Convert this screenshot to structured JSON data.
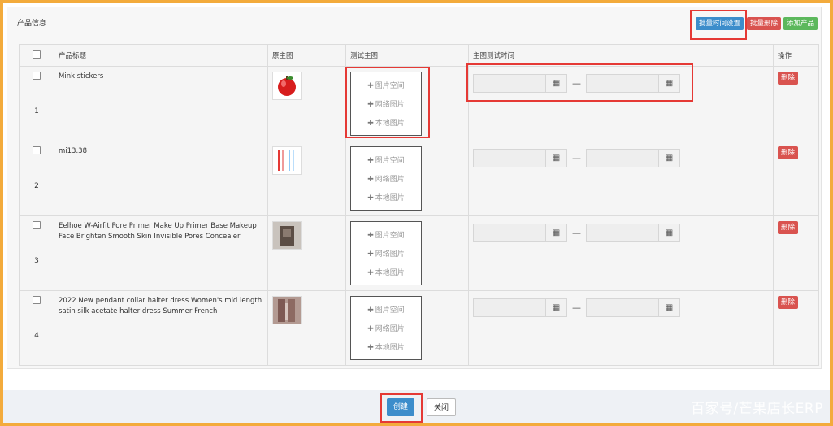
{
  "panel": {
    "title": "产品信息"
  },
  "toolbar": {
    "batch_time_label": "批量时间设置",
    "batch_delete_label": "批量删除",
    "add_product_label": "添加产品"
  },
  "table": {
    "headers": {
      "product_title": "产品标题",
      "original_image": "原主图",
      "test_image": "测试主图",
      "test_time": "主图测试时间",
      "action": "操作"
    },
    "image_options": [
      "图片空间",
      "网络图片",
      "本地图片"
    ],
    "date_separator": "—",
    "delete_label": "删除",
    "rows": [
      {
        "num": "1",
        "title": "Mink stickers"
      },
      {
        "num": "2",
        "title": "mi13.38"
      },
      {
        "num": "3",
        "title": "Eelhoe W-Airfit Pore Primer Make Up Primer Base Makeup Face Brighten Smooth Skin Invisible Pores Concealer"
      },
      {
        "num": "4",
        "title": "2022 New pendant collar halter dress Women's mid length satin silk acetate halter dress Summer French"
      }
    ]
  },
  "footer": {
    "create_label": "创建",
    "close_label": "关闭"
  },
  "watermark": "百家号/芒果店长ERP",
  "icons": {
    "calendar": "calendar-icon",
    "plus": "plus-icon"
  },
  "colors": {
    "primary": "#3c8dcb",
    "danger": "#d9534f",
    "success": "#5cb85c",
    "highlight": "#e53935",
    "frame": "#f3ab3c"
  }
}
